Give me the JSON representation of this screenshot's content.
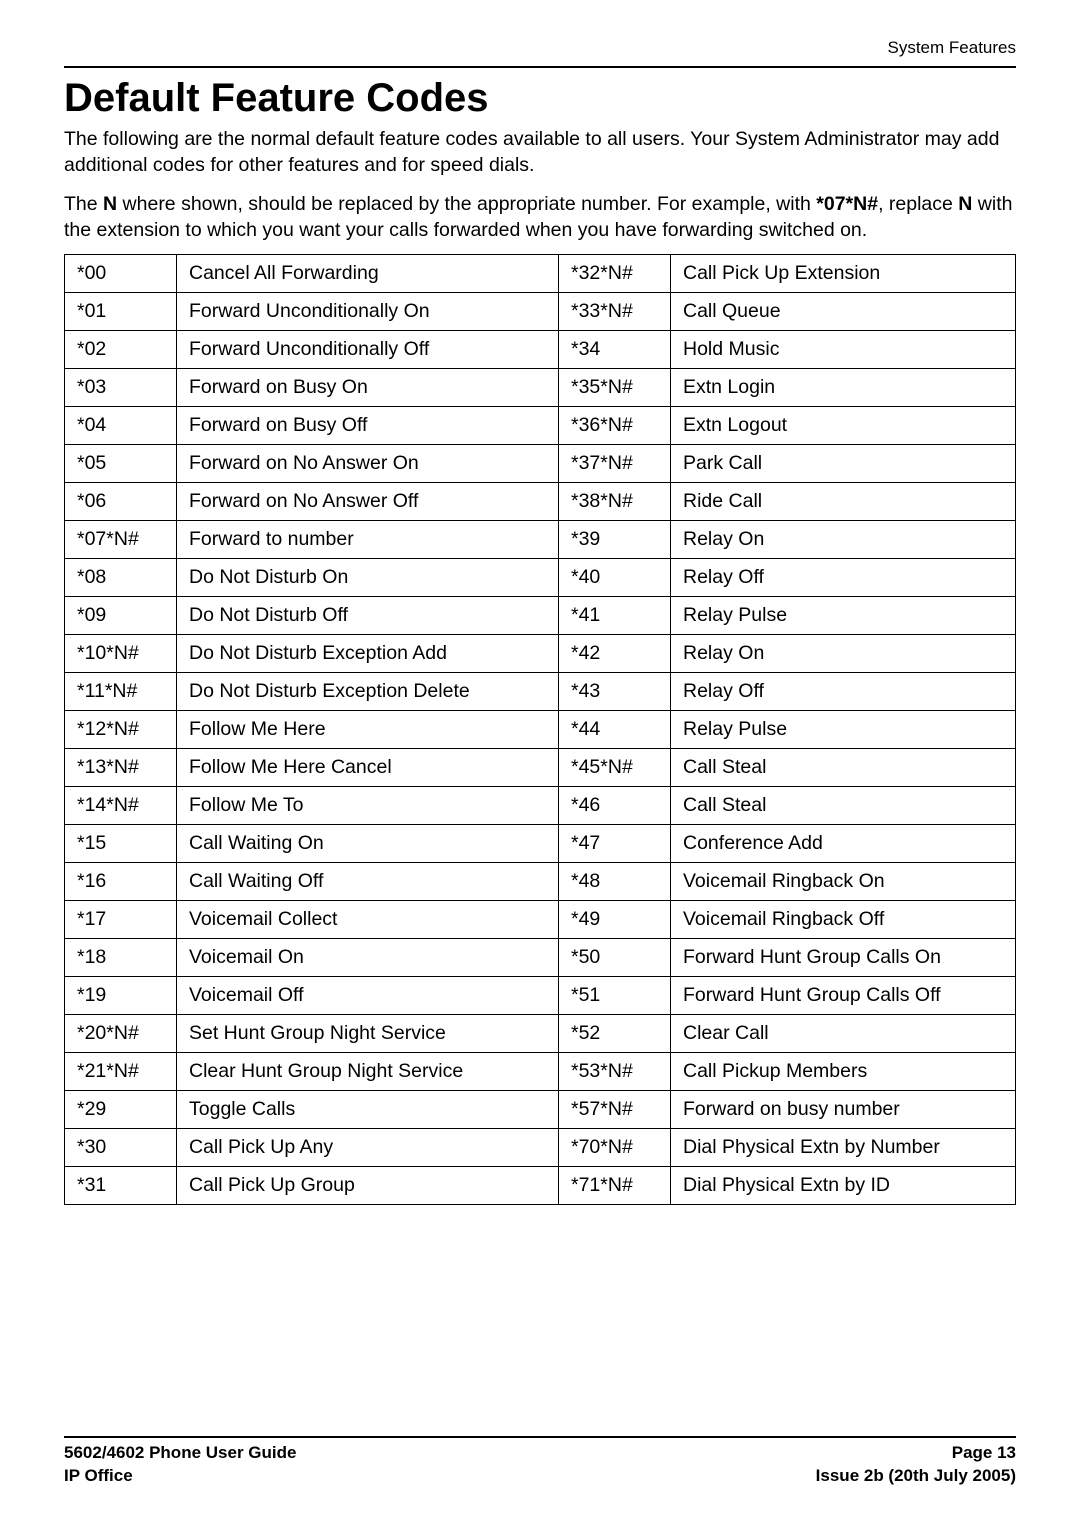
{
  "running_head": "System Features",
  "title": "Default Feature Codes",
  "intro1": "The following are the normal default feature codes available to all users. Your System Administrator may add additional codes for other features and for speed dials.",
  "intro2_pre": "The ",
  "intro2_bold1": "N",
  "intro2_mid": " where shown, should be replaced by the appropriate number. For example, with ",
  "intro2_bold2": "*07*N#",
  "intro2_post1": ", replace ",
  "intro2_bold3": "N",
  "intro2_post2": " with the extension to which you want your calls forwarded when you have forwarding switched on.",
  "codes": [
    {
      "c1": "*00",
      "c2": "Cancel All Forwarding",
      "c3": "*32*N#",
      "c4": "Call Pick Up Extension"
    },
    {
      "c1": "*01",
      "c2": "Forward Unconditionally On",
      "c3": "*33*N#",
      "c4": "Call Queue"
    },
    {
      "c1": "*02",
      "c2": "Forward Unconditionally Off",
      "c3": "*34",
      "c4": "Hold Music"
    },
    {
      "c1": "*03",
      "c2": "Forward on Busy On",
      "c3": "*35*N#",
      "c4": "Extn Login"
    },
    {
      "c1": "*04",
      "c2": "Forward on Busy Off",
      "c3": "*36*N#",
      "c4": "Extn Logout"
    },
    {
      "c1": "*05",
      "c2": "Forward on No Answer On",
      "c3": "*37*N#",
      "c4": "Park Call"
    },
    {
      "c1": "*06",
      "c2": "Forward on No Answer Off",
      "c3": "*38*N#",
      "c4": "Ride Call"
    },
    {
      "c1": "*07*N#",
      "c2": "Forward to number",
      "c3": "*39",
      "c4": "Relay On"
    },
    {
      "c1": "*08",
      "c2": "Do Not Disturb On",
      "c3": "*40",
      "c4": "Relay Off"
    },
    {
      "c1": "*09",
      "c2": "Do Not Disturb Off",
      "c3": "*41",
      "c4": "Relay Pulse"
    },
    {
      "c1": "*10*N#",
      "c2": "Do Not Disturb Exception Add",
      "c3": "*42",
      "c4": "Relay On"
    },
    {
      "c1": "*11*N#",
      "c2": "Do Not Disturb Exception Delete",
      "c3": "*43",
      "c4": "Relay Off"
    },
    {
      "c1": "*12*N#",
      "c2": "Follow Me Here",
      "c3": "*44",
      "c4": "Relay Pulse"
    },
    {
      "c1": "*13*N#",
      "c2": "Follow Me Here Cancel",
      "c3": "*45*N#",
      "c4": "Call Steal"
    },
    {
      "c1": "*14*N#",
      "c2": "Follow Me To",
      "c3": "*46",
      "c4": "Call Steal"
    },
    {
      "c1": "*15",
      "c2": "Call Waiting On",
      "c3": "*47",
      "c4": "Conference Add"
    },
    {
      "c1": "*16",
      "c2": "Call Waiting Off",
      "c3": "*48",
      "c4": "Voicemail Ringback On"
    },
    {
      "c1": "*17",
      "c2": "Voicemail Collect",
      "c3": "*49",
      "c4": "Voicemail Ringback Off"
    },
    {
      "c1": "*18",
      "c2": "Voicemail On",
      "c3": "*50",
      "c4": "Forward Hunt Group Calls On"
    },
    {
      "c1": "*19",
      "c2": "Voicemail Off",
      "c3": "*51",
      "c4": "Forward Hunt Group Calls Off"
    },
    {
      "c1": "*20*N#",
      "c2": "Set Hunt Group Night Service",
      "c3": "*52",
      "c4": "Clear Call"
    },
    {
      "c1": "*21*N#",
      "c2": "Clear Hunt Group Night Service",
      "c3": "*53*N#",
      "c4": "Call Pickup Members"
    },
    {
      "c1": "*29",
      "c2": "Toggle Calls",
      "c3": "*57*N#",
      "c4": "Forward on busy number"
    },
    {
      "c1": "*30",
      "c2": "Call Pick Up Any",
      "c3": "*70*N#",
      "c4": "Dial Physical Extn by Number"
    },
    {
      "c1": "*31",
      "c2": "Call Pick Up Group",
      "c3": "*71*N#",
      "c4": "Dial Physical Extn by ID"
    }
  ],
  "footer": {
    "l1": "5602/4602 Phone User Guide",
    "l2": "IP Office",
    "r1": "Page 13",
    "r2": "Issue 2b (20th July 2005)"
  }
}
